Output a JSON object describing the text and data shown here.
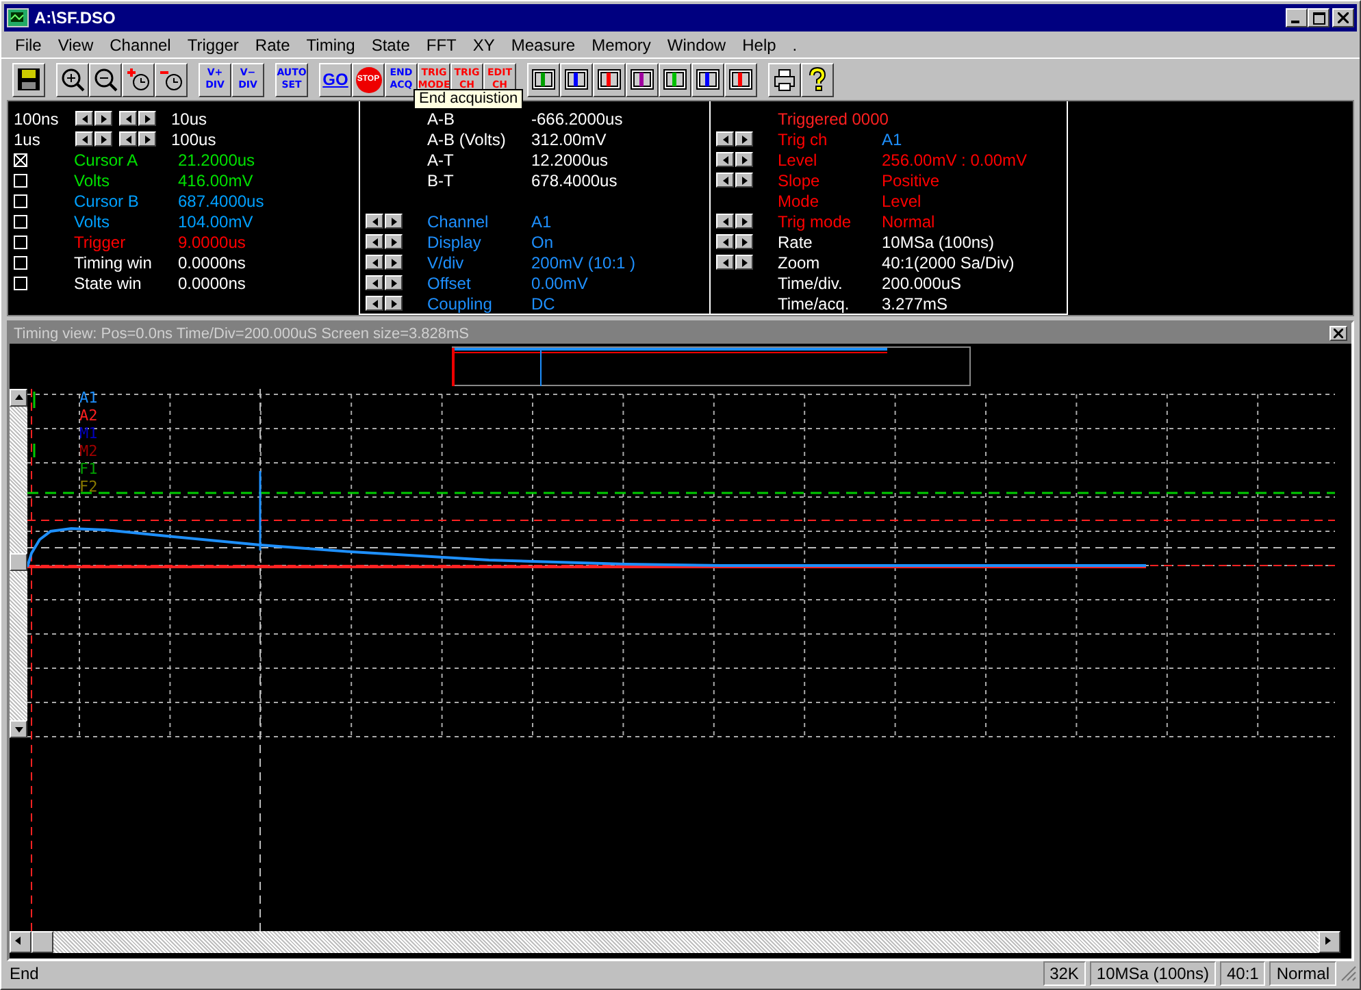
{
  "window": {
    "title": "A:\\SF.DSO"
  },
  "menu": [
    "File",
    "View",
    "Channel",
    "Trigger",
    "Rate",
    "Timing",
    "State",
    "FFT",
    "XY",
    "Measure",
    "Memory",
    "Window",
    "Help",
    "."
  ],
  "toolbar": [
    {
      "kind": "save"
    },
    {
      "kind": "sep"
    },
    {
      "kind": "zoomin"
    },
    {
      "kind": "zoomout"
    },
    {
      "kind": "plus"
    },
    {
      "kind": "minus"
    },
    {
      "kind": "sep"
    },
    {
      "kind": "text",
      "lines": [
        "V+",
        "DIV"
      ],
      "color": "#0000ff"
    },
    {
      "kind": "text",
      "lines": [
        "V−",
        "DIV"
      ],
      "color": "#0000ff"
    },
    {
      "kind": "sep"
    },
    {
      "kind": "text",
      "lines": [
        "AUTO",
        "SET"
      ],
      "color": "#0000ff"
    },
    {
      "kind": "sep"
    },
    {
      "kind": "go",
      "lines": [
        "GO"
      ],
      "color": "#0000ff"
    },
    {
      "kind": "stop",
      "lines": [
        "STOP"
      ],
      "color": "#ffffff"
    },
    {
      "kind": "text",
      "lines": [
        "END",
        "ACQ"
      ],
      "color": "#0000ff"
    },
    {
      "kind": "text",
      "lines": [
        "TRIG",
        "MODE"
      ],
      "color": "#ff0000"
    },
    {
      "kind": "text",
      "lines": [
        "TRIG",
        "CH"
      ],
      "color": "#ff0000"
    },
    {
      "kind": "text",
      "lines": [
        "EDIT",
        "CH"
      ],
      "color": "#ff0000"
    },
    {
      "kind": "sep"
    },
    {
      "kind": "view",
      "color": "#00a000"
    },
    {
      "kind": "view",
      "color": "#0000ff"
    },
    {
      "kind": "view",
      "color": "#ff0000"
    },
    {
      "kind": "view",
      "color": "#a000a0"
    },
    {
      "kind": "view",
      "color": "#00c000"
    },
    {
      "kind": "view",
      "color": "#0000ff"
    },
    {
      "kind": "view",
      "color": "#ff0000"
    },
    {
      "kind": "sep"
    },
    {
      "kind": "print"
    },
    {
      "kind": "help"
    }
  ],
  "tooltip": "End acquistion",
  "left_panel": {
    "ranges": [
      {
        "label": "100ns",
        "value": "10us"
      },
      {
        "label": "1us",
        "value": "100us"
      }
    ],
    "cursors": [
      {
        "label": "Cursor A",
        "value": "21.2000us",
        "checked": true,
        "color": "#00e000"
      },
      {
        "label": "Volts",
        "value": "416.00mV",
        "checked": false,
        "color": "#00e000"
      },
      {
        "label": "Cursor B",
        "value": "687.4000us",
        "checked": false,
        "color": "#00a0ff"
      },
      {
        "label": "Volts",
        "value": "104.00mV",
        "checked": false,
        "color": "#00a0ff"
      },
      {
        "label": "Trigger",
        "value": "9.0000us",
        "checked": false,
        "color": "#ff0000"
      },
      {
        "label": "Timing win",
        "value": "0.0000ns",
        "checked": false,
        "color": "#ffffff"
      },
      {
        "label": "State win",
        "value": "0.0000ns",
        "checked": false,
        "color": "#ffffff"
      }
    ]
  },
  "measurements": [
    {
      "label": "A-B",
      "value": "-666.2000us"
    },
    {
      "label": "A-B (Volts)",
      "value": "312.00mV"
    },
    {
      "label": "A-T",
      "value": "12.2000us"
    },
    {
      "label": "B-T",
      "value": "678.4000us"
    }
  ],
  "channel_settings": [
    {
      "label": "Channel",
      "value": "A1"
    },
    {
      "label": "Display",
      "value": "On"
    },
    {
      "label": "V/div",
      "value": "200mV (10:1  )"
    },
    {
      "label": "Offset",
      "value": " 0.00mV"
    },
    {
      "label": "Coupling",
      "value": "DC"
    }
  ],
  "trigger_status": "Triggered 0000",
  "trigger_settings": [
    {
      "label": {
        "text": "Trig ch",
        "color": "#ff0000"
      },
      "value": {
        "text": "A1",
        "color": "#1e90ff"
      },
      "arrows": true
    },
    {
      "label": {
        "text": "Level",
        "color": "#ff0000"
      },
      "value": {
        "text": "256.00mV : 0.00mV",
        "color": "#ff0000"
      },
      "arrows": true
    },
    {
      "label": {
        "text": "Slope",
        "color": "#ff0000"
      },
      "value": {
        "text": "Positive",
        "color": "#ff0000"
      },
      "arrows": true
    },
    {
      "label": {
        "text": "Mode",
        "color": "#ff0000"
      },
      "value": {
        "text": "Level",
        "color": "#ff0000"
      },
      "arrows": false
    },
    {
      "label": {
        "text": "Trig mode",
        "color": "#ff0000"
      },
      "value": {
        "text": "Normal",
        "color": "#ff0000"
      },
      "arrows": true
    },
    {
      "label": {
        "text": "Rate",
        "color": "#ffffff"
      },
      "value": {
        "text": "10MSa (100ns)",
        "color": "#ffffff"
      },
      "arrows": true
    },
    {
      "label": {
        "text": "Zoom",
        "color": "#ffffff"
      },
      "value": {
        "text": " 40:1(2000 Sa/Div)",
        "color": "#ffffff"
      },
      "arrows": true
    },
    {
      "label": {
        "text": "Time/div.",
        "color": "#ffffff"
      },
      "value": {
        "text": "200.000uS",
        "color": "#ffffff"
      },
      "arrows": false
    },
    {
      "label": {
        "text": "Time/acq.",
        "color": "#ffffff"
      },
      "value": {
        "text": "3.277mS",
        "color": "#ffffff"
      },
      "arrows": false
    }
  ],
  "timing_view": {
    "title": "Timing view: Pos=0.0ns Time/Div=200.000uS Screen size=3.828mS",
    "traces": [
      {
        "name": "A1",
        "color": "#1e90ff"
      },
      {
        "name": "A2",
        "color": "#ff2020"
      },
      {
        "name": "M1",
        "color": "#0000c0"
      },
      {
        "name": "M2",
        "color": "#a00000"
      },
      {
        "name": "F1",
        "color": "#00a000"
      },
      {
        "name": "F2",
        "color": "#8a7a00"
      }
    ]
  },
  "status_bar": {
    "message": "End",
    "panels": [
      "32K",
      "10MSa (100ns)",
      "40:1",
      "Normal"
    ]
  }
}
